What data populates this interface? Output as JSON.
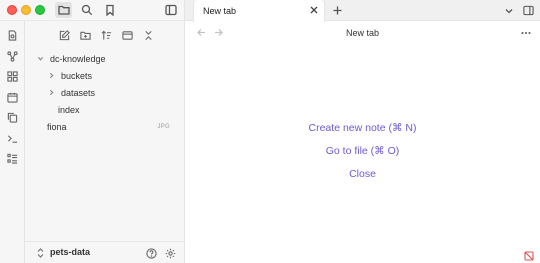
{
  "sidebar": {
    "tree": {
      "root": "dc-knowledge",
      "items": [
        {
          "label": "buckets"
        },
        {
          "label": "datasets"
        },
        {
          "label": "index"
        }
      ],
      "loose_file": {
        "label": "fiona",
        "tag": "JPG"
      }
    },
    "vault": {
      "name": "pets-data"
    }
  },
  "tabs": [
    {
      "title": "New tab"
    }
  ],
  "view": {
    "title": "New tab"
  },
  "empty_state": {
    "create_note": "Create new note (⌘ N)",
    "go_to_file": "Go to file (⌘ O)",
    "close": "Close"
  },
  "colors": {
    "accent": "#6d5bd0",
    "traffic_close": "#ff5f57",
    "traffic_minimize": "#febc2e",
    "traffic_maximize": "#28c840"
  }
}
